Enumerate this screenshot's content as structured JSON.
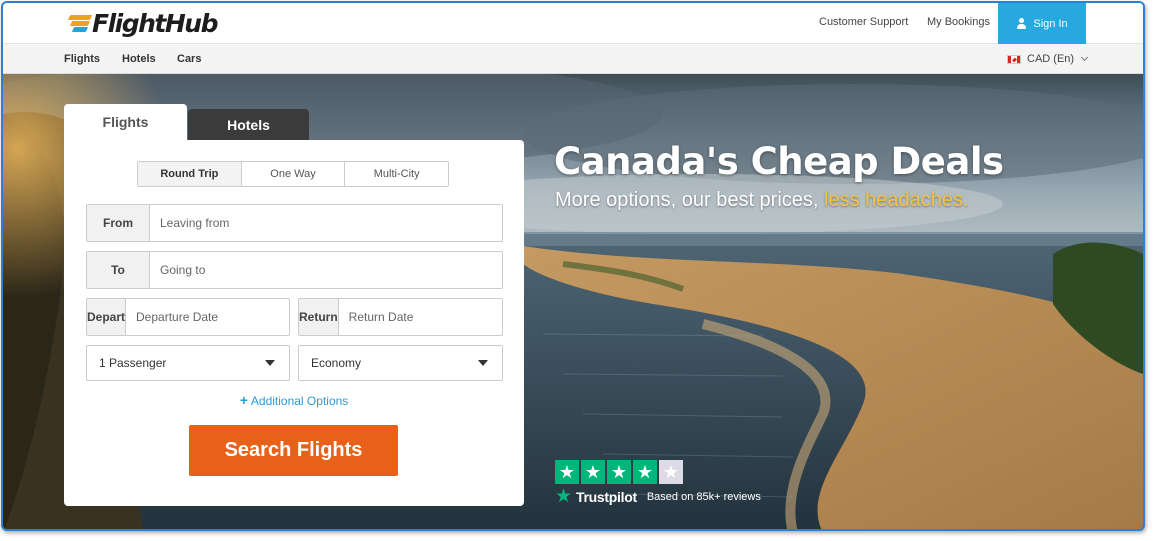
{
  "header": {
    "logo_text": "FlightHub",
    "links": [
      "Customer Support",
      "My Bookings"
    ],
    "signin_label": "Sign In"
  },
  "subnav": {
    "items": [
      "Flights",
      "Hotels",
      "Cars"
    ],
    "currency": "CAD (En)"
  },
  "search": {
    "tabs": [
      "Flights",
      "Hotels"
    ],
    "active_tab": "Flights",
    "trip_types": [
      "Round Trip",
      "One Way",
      "Multi-City"
    ],
    "active_trip": "Round Trip",
    "from_label": "From",
    "from_placeholder": "Leaving from",
    "to_label": "To",
    "to_placeholder": "Going to",
    "depart_label": "Depart",
    "depart_placeholder": "Departure Date",
    "return_label": "Return",
    "return_placeholder": "Return Date",
    "passengers": "1 Passenger",
    "cabin_class": "Economy",
    "additional_options": "Additional Options",
    "submit_label": "Search Flights"
  },
  "hero": {
    "headline": "Canada's Cheap Deals",
    "subhead_main": "More options, our best prices, ",
    "subhead_accent": "less headaches."
  },
  "trustpilot": {
    "rating_stars": 4,
    "max_stars": 5,
    "brand": "Trustpilot",
    "based_on": "Based on 85k+ reviews"
  },
  "colors": {
    "frame_border": "#2a7fd6",
    "signin_bg": "#29a8e0",
    "search_button": "#e8611a",
    "link_blue": "#2b9bd8",
    "accent_yellow": "#f6c144",
    "trustpilot_green": "#00b67a",
    "logo_orange": "#f0a020",
    "logo_blue": "#2aa0d8"
  },
  "icons": {
    "signin": "user-icon",
    "currency_flag": "canada-flag-icon",
    "currency_dropdown": "chevron-down-icon",
    "select_caret": "caret-down-icon",
    "additional": "plus-icon",
    "rating": "star-icon"
  }
}
